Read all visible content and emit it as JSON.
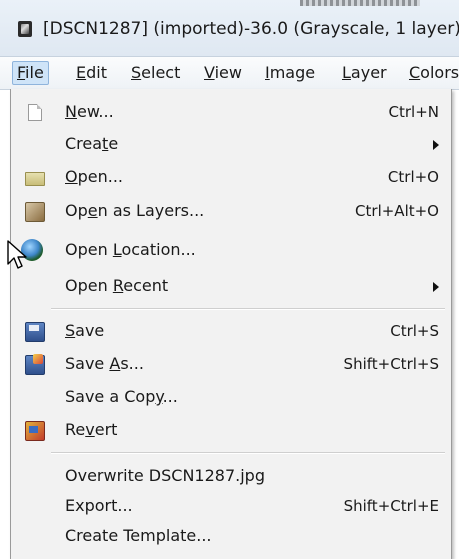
{
  "window": {
    "title": "[DSCN1287] (imported)-36.0 (Grayscale, 1 layer)"
  },
  "menubar": {
    "items": [
      {
        "pre": "",
        "u": "F",
        "post": "ile"
      },
      {
        "pre": "",
        "u": "E",
        "post": "dit"
      },
      {
        "pre": "",
        "u": "S",
        "post": "elect"
      },
      {
        "pre": "",
        "u": "V",
        "post": "iew"
      },
      {
        "pre": "",
        "u": "I",
        "post": "mage"
      },
      {
        "pre": "",
        "u": "L",
        "post": "ayer"
      },
      {
        "pre": "",
        "u": "C",
        "post": "olors"
      }
    ]
  },
  "file_menu": {
    "items": [
      {
        "icon": "new-document-icon",
        "pre": "",
        "u": "N",
        "post": "ew...",
        "shortcut": "Ctrl+N"
      },
      {
        "icon": "",
        "pre": "Crea",
        "u": "t",
        "post": "e",
        "submenu": true
      },
      {
        "icon": "open-folder-icon",
        "pre": "",
        "u": "O",
        "post": "pen...",
        "shortcut": "Ctrl+O"
      },
      {
        "icon": "open-layers-icon",
        "pre": "Op",
        "u": "e",
        "post": "n as Layers...",
        "shortcut": "Ctrl+Alt+O"
      },
      {
        "icon": "globe-icon",
        "pre": "Open ",
        "u": "L",
        "post": "ocation..."
      },
      {
        "icon": "",
        "pre": "Open ",
        "u": "R",
        "post": "ecent",
        "submenu": true
      },
      {
        "icon": "save-icon",
        "pre": "",
        "u": "S",
        "post": "ave",
        "shortcut": "Ctrl+S"
      },
      {
        "icon": "save-as-icon",
        "pre": "Save ",
        "u": "A",
        "post": "s...",
        "shortcut": "Shift+Ctrl+S"
      },
      {
        "icon": "",
        "pre": "Save a Cop",
        "u": "y",
        "post": "..."
      },
      {
        "icon": "revert-icon",
        "pre": "Re",
        "u": "v",
        "post": "ert"
      },
      {
        "icon": "",
        "pre": "Overwrite DSCN1287.jpg",
        "u": "",
        "post": ""
      },
      {
        "icon": "",
        "pre": "Export...",
        "u": "",
        "post": "",
        "shortcut": "Shift+Ctrl+E"
      },
      {
        "icon": "",
        "pre": "Create Template...",
        "u": "",
        "post": ""
      }
    ]
  }
}
